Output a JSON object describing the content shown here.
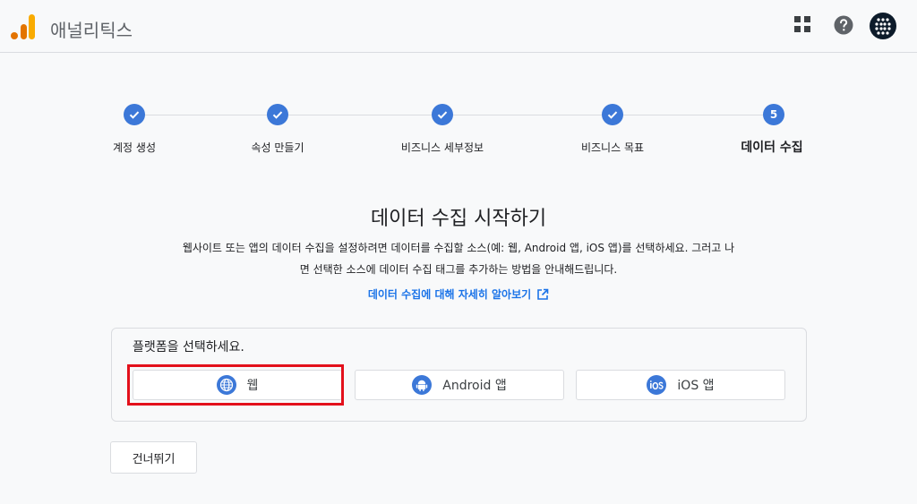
{
  "header": {
    "app_title": "애널리틱스",
    "icons": [
      "analytics-logo",
      "apps-grid-icon",
      "help-icon",
      "account-avatar"
    ]
  },
  "stepper": {
    "steps": [
      {
        "label": "계정 생성",
        "state": "done"
      },
      {
        "label": "속성 만들기",
        "state": "done"
      },
      {
        "label": "비즈니스 세부정보",
        "state": "done"
      },
      {
        "label": "비즈니스 목표",
        "state": "done"
      },
      {
        "label": "데이터 수집",
        "state": "active",
        "number": "5"
      }
    ]
  },
  "main": {
    "title": "데이터 수집 시작하기",
    "description_line1": "웹사이트 또는 앱의 데이터 수집을 설정하려면 데이터를 수집할 소스(예: 웹, Android 앱, iOS 앱)를 선택하세요. 그러고 나",
    "description_line2": "면 선택한 소스에 데이터 수집 태그를 추가하는 방법을 안내해드립니다.",
    "learn_more": "데이터 수집에 대해 자세히 알아보기"
  },
  "platform": {
    "prompt": "플랫폼을 선택하세요.",
    "options": [
      {
        "label": "웹",
        "icon": "globe-icon"
      },
      {
        "label": "Android 앱",
        "icon": "android-icon"
      },
      {
        "label": "iOS 앱",
        "icon": "ios-icon"
      }
    ]
  },
  "skip_label": "건너뛰기",
  "colors": {
    "accent": "#3c78d8",
    "link": "#1a73e8",
    "highlight": "#e3101b",
    "logo_orange": "#f9ab00",
    "logo_dark_orange": "#e37400"
  }
}
